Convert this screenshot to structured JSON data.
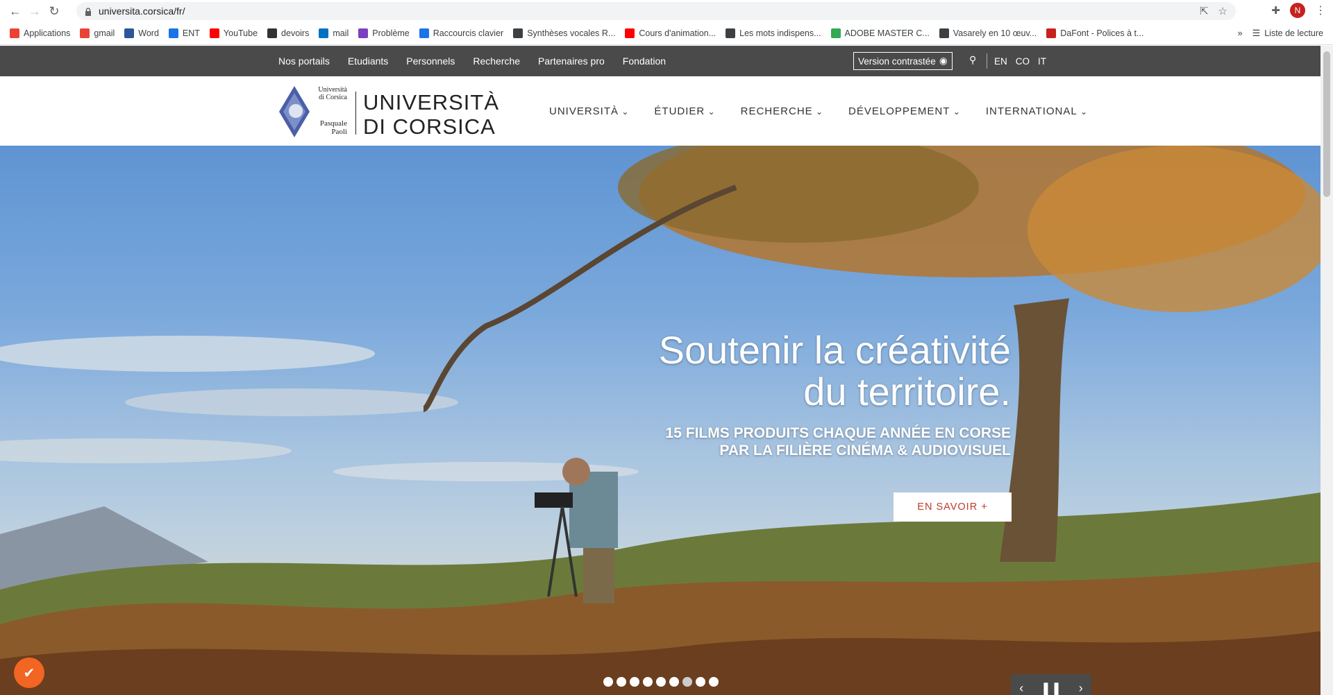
{
  "browser": {
    "url": "universita.corsica/fr/",
    "avatar_letter": "N",
    "bookmarks": [
      {
        "label": "Applications",
        "color": "#ea4335"
      },
      {
        "label": "gmail",
        "color": "#ea4335"
      },
      {
        "label": "Word",
        "color": "#2b579a"
      },
      {
        "label": "ENT",
        "color": "#1a73e8"
      },
      {
        "label": "YouTube",
        "color": "#ff0000"
      },
      {
        "label": "devoirs",
        "color": "#333333"
      },
      {
        "label": "mail",
        "color": "#0072c6"
      },
      {
        "label": "Problème",
        "color": "#7b3fbf"
      },
      {
        "label": "Raccourcis clavier",
        "color": "#1a73e8"
      },
      {
        "label": "Synthèses vocales R...",
        "color": "#3c4043"
      },
      {
        "label": "Cours d'animation...",
        "color": "#ff0000"
      },
      {
        "label": "Les mots indispens...",
        "color": "#3c4043"
      },
      {
        "label": "ADOBE MASTER C...",
        "color": "#34a853"
      },
      {
        "label": "Vasarely en 10 œuv...",
        "color": "#3c4043"
      },
      {
        "label": "DaFont - Polices à t...",
        "color": "#c5221f"
      }
    ],
    "overflow_label": "»",
    "reading_list_label": "Liste de lecture"
  },
  "topbar": {
    "links": [
      "Nos portails",
      "Etudiants",
      "Personnels",
      "Recherche",
      "Partenaires pro",
      "Fondation"
    ],
    "contrast_label": "Version contrastée",
    "languages": [
      "EN",
      "CO",
      "IT"
    ]
  },
  "header": {
    "logo_small": [
      "Università",
      "di Corsica",
      "Pasquale",
      "Paoli"
    ],
    "logo_line1": "UNIVERSITÀ",
    "logo_line2": "DI CORSICA",
    "nav": [
      "UNIVERSITÀ",
      "ÉTUDIER",
      "RECHERCHE",
      "DÉVELOPPEMENT",
      "INTERNATIONAL"
    ]
  },
  "hero": {
    "title_line1": "Soutenir la créativité",
    "title_line2": "du territoire.",
    "subtitle_line1": "15 FILMS PRODUITS CHAQUE ANNÉE EN CORSE",
    "subtitle_line2": "PAR LA FILIÈRE CINÉMA & AUDIOVISUEL",
    "cta_label": "EN SAVOIR +",
    "slide_count": 9,
    "active_slide": 7
  },
  "colors": {
    "topbar_bg": "#4a4a4a",
    "cta_text": "#c0392b",
    "fab": "#f26522"
  }
}
